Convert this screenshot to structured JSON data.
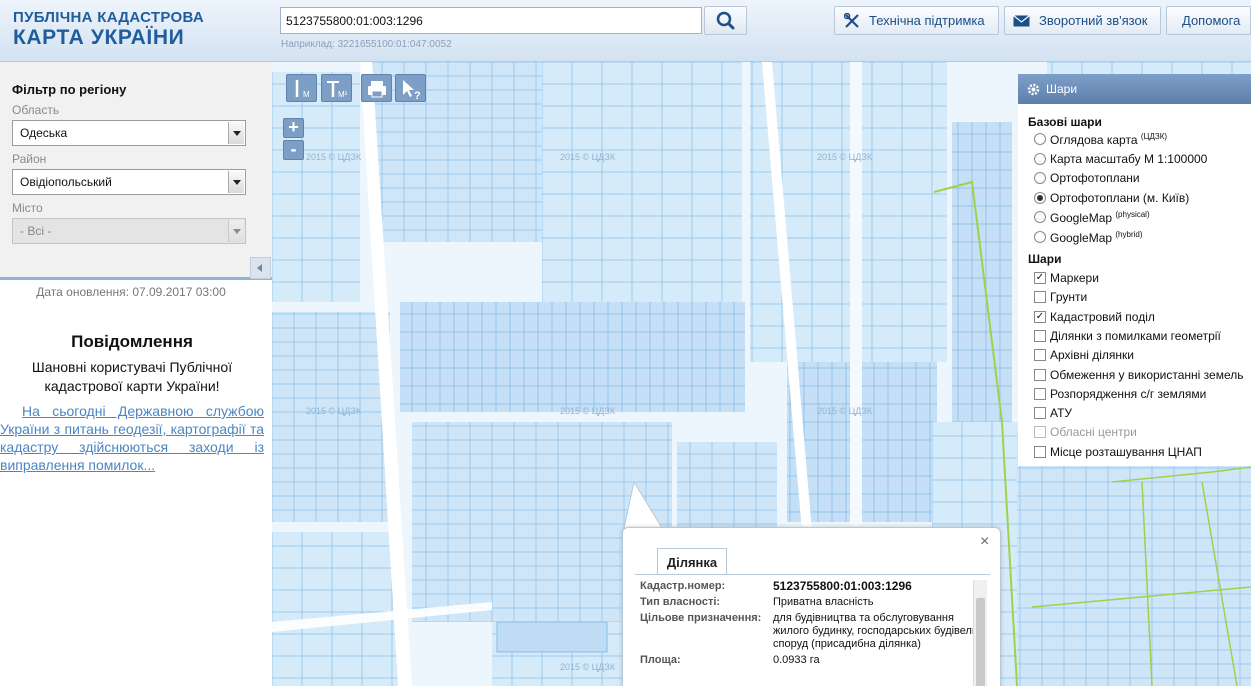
{
  "header": {
    "logo_line1": "ПУБЛІЧНА КАДАСТРОВА",
    "logo_line2": "КАРТА УКРАЇНИ",
    "search_value": "5123755800:01:003:1296",
    "search_hint": "Наприклад: 3221655100:01:047:0052",
    "support_label": "Технічна підтримка",
    "feedback_label": "Зворотний зв'язок",
    "help_label": "Допомога"
  },
  "filter": {
    "title": "Фільтр по регіону",
    "oblast_label": "Область",
    "oblast_value": "Одеська",
    "rayon_label": "Район",
    "rayon_value": "Овідіопольський",
    "city_label": "Місто",
    "city_value": "- Всі -"
  },
  "sidebar": {
    "updated": "Дата оновлення: 07.09.2017 03:00",
    "notice_title": "Повідомлення",
    "notice_body": "Шановні користувачі Публічної кадастрової карти України!",
    "notice_link": "На сьогодні Державною службою України з питань геодезії, картографії та кадастру здійснюються заходи із виправлення помилок..."
  },
  "map": {
    "watermark": "2015 © ЦДЗК",
    "zoom_in": "+",
    "zoom_out": "-",
    "tool_measure_line": "М",
    "tool_measure_area": "М²",
    "tool_query": "?"
  },
  "layers": {
    "title": "Шари",
    "base_title": "Базові шари",
    "base": [
      {
        "label": "Оглядова карта",
        "sup": "(ЦДЗК)",
        "selected": false
      },
      {
        "label": "Карта масштабу М 1:100000",
        "sup": "",
        "selected": false
      },
      {
        "label": "Ортофотоплани",
        "sup": "",
        "selected": false
      },
      {
        "label": "Ортофотоплани (м. Київ)",
        "sup": "",
        "selected": true
      },
      {
        "label": "GoogleMap",
        "sup": "(physical)",
        "selected": false
      },
      {
        "label": "GoogleMap",
        "sup": "(hybrid)",
        "selected": false
      }
    ],
    "overlay_title": "Шари",
    "overlays": [
      {
        "label": "Маркери",
        "checked": true,
        "disabled": false
      },
      {
        "label": "Грунти",
        "checked": false,
        "disabled": false
      },
      {
        "label": "Кадастровий поділ",
        "checked": true,
        "disabled": false
      },
      {
        "label": "Ділянки з помилками геометрії",
        "checked": false,
        "disabled": false
      },
      {
        "label": "Архівні ділянки",
        "checked": false,
        "disabled": false
      },
      {
        "label": "Обмеження у використанні земель",
        "checked": false,
        "disabled": false
      },
      {
        "label": "Розпорядження с/г землями",
        "checked": false,
        "disabled": false
      },
      {
        "label": "АТУ",
        "checked": false,
        "disabled": false
      },
      {
        "label": "Обласні центри",
        "checked": false,
        "disabled": true
      },
      {
        "label": "Місце розташування ЦНАП",
        "checked": false,
        "disabled": false
      }
    ]
  },
  "popup": {
    "tab": "Ділянка",
    "close": "×",
    "rows": [
      {
        "key": "Кадастр.номер:",
        "value": "5123755800:01:003:1296",
        "bold": true
      },
      {
        "key": "Тип власності:",
        "value": "Приватна власність",
        "bold": false
      },
      {
        "key": "Цільове призначення:",
        "value": "для будівництва та обслуговування жилого будинку, господарських будівель і споруд (присадибна ділянка)",
        "bold": false
      },
      {
        "key": "Площа:",
        "value": "0.0933 га",
        "bold": false
      }
    ]
  },
  "colors": {
    "accent": "#1f5d9c",
    "parcel_fill": "#cfe6f8",
    "parcel_stroke": "#8fc3ea",
    "boundary_green": "#9fd24a",
    "link": "#4a86c4"
  }
}
